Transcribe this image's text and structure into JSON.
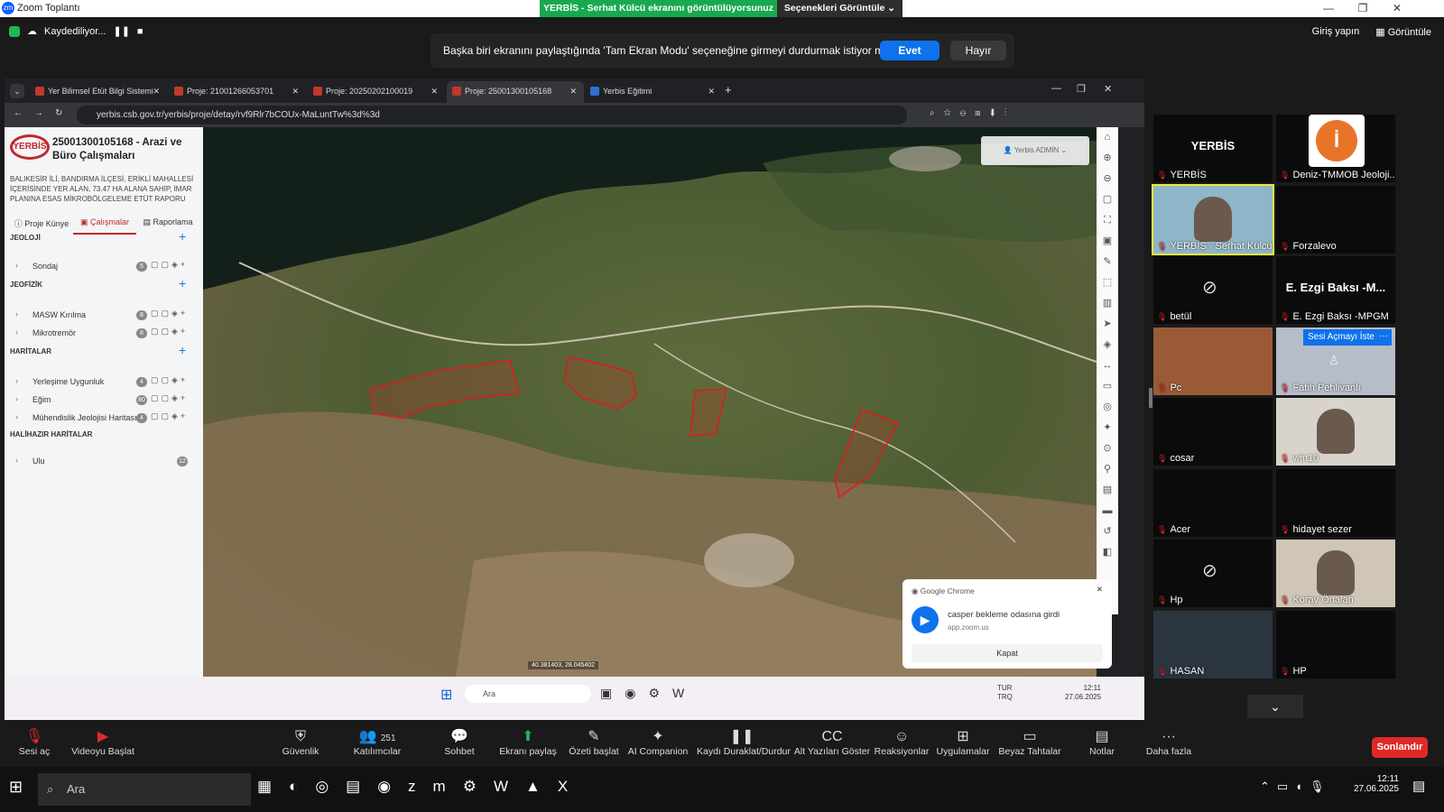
{
  "window": {
    "title": "Zoom Toplantı",
    "share_status": "YERBİS - Serhat Külcü ekranını görüntülüyorsunuz",
    "view_options": "Seçenekleri Görüntüle"
  },
  "recording": {
    "label": "Kaydediliyor..."
  },
  "prompt": {
    "text": "Başka biri ekranını paylaştığında 'Tam Ekran Modu' seçeneğine girmeyi durdurmak istiyor musunuz?",
    "yes": "Evet",
    "no": "Hayır"
  },
  "topright": {
    "signin": "Giriş yapın",
    "view": "Görüntüle"
  },
  "browser": {
    "tabs": [
      "Yer Bilimsel Etüt Bilgi Sistemi",
      "Proje: 21001266053701",
      "Proje: 20250202100019",
      "Proje: 25001300105168",
      "Yerbis Eğitimi"
    ],
    "url": "yerbis.csb.gov.tr/yerbis/proje/detay/rvf9Rlr7bCOUx-MaLuntTw%3d%3d"
  },
  "panel": {
    "logo": "YERBİS",
    "title": "25001300105168 - Arazi ve Büro Çalışmaları",
    "desc": "BALIKESİR İLİ, BANDIRMA İLÇESİ, ERİKLİ MAHALLESİ İÇERİSİNDE YER ALAN, 73.47 HA ALANA SAHİP, İMAR PLANINA ESAS MİKROBÖLGELEME ETÜT RAPORU",
    "tabs": [
      "Proje Künye",
      "Çalışmalar",
      "Raporlama"
    ],
    "sections": [
      {
        "name": "JEOLOJİ",
        "rows": [
          {
            "name": "Sondaj",
            "count": "5"
          }
        ]
      },
      {
        "name": "JEOFİZİK",
        "rows": [
          {
            "name": "MASW Kırılma",
            "count": "8"
          },
          {
            "name": "Mikrotremör",
            "count": "8"
          }
        ]
      },
      {
        "name": "HARİTALAR",
        "rows": [
          {
            "name": "Yerleşime Uygunluk",
            "count": "4"
          },
          {
            "name": "Eğim",
            "count": "80"
          },
          {
            "name": "Mühendislik Jeolojisi Haritası",
            "count": "4"
          }
        ]
      },
      {
        "name": "HALİHAZIR HARİTALAR",
        "rows": [
          {
            "name": "Ulu",
            "count": "12"
          }
        ]
      }
    ]
  },
  "map": {
    "user": "Yerbis ADMİN",
    "coords": "40.381403, 28.045402"
  },
  "notification": {
    "app": "Google Chrome",
    "message": "casper bekleme odasına girdi",
    "source": "app.zoom.us",
    "close": "Kapat"
  },
  "inner_taskbar": {
    "search": "Ara",
    "lang": "TUR",
    "lang2": "TRQ",
    "time": "12:11",
    "date": "27.06.2025"
  },
  "participants": [
    "YERBİS",
    "Deniz-TMMOB Jeoloji...",
    "YERBİS - Serhat Külcü",
    "Forzalevo",
    "betül",
    "E. Ezgi Baksı -MPGM",
    "Pc",
    "Fatih Pehlivanlı",
    "cosar",
    "win10",
    "Acer",
    "hidayet sezer",
    "Hp",
    "Koray Önalan",
    "HASAN",
    "HP"
  ],
  "participant_big": {
    "t0": "YERBİS",
    "t5": "E. Ezgi Baksı -M..."
  },
  "unmute_request": "Sesi Açmayı İste",
  "toolbar": {
    "mute": "Sesi aç",
    "video": "Videoyu Başlat",
    "security": "Güvenlik",
    "participants": "Katılımcılar",
    "participant_count": "251",
    "chat": "Sohbet",
    "share": "Ekranı paylaş",
    "summary": "Özeti başlat",
    "ai": "AI Companion",
    "record": "Kaydı Duraklat/Durdur",
    "captions": "Alt Yazıları Göster",
    "reactions": "Reaksiyonlar",
    "apps": "Uygulamalar",
    "whiteboards": "Beyaz Tahtalar",
    "notes": "Notlar",
    "more": "Daha fazla",
    "end": "Sonlandır"
  },
  "windows_taskbar": {
    "search": "Ara",
    "time": "12:11",
    "date": "27.06.2025"
  }
}
